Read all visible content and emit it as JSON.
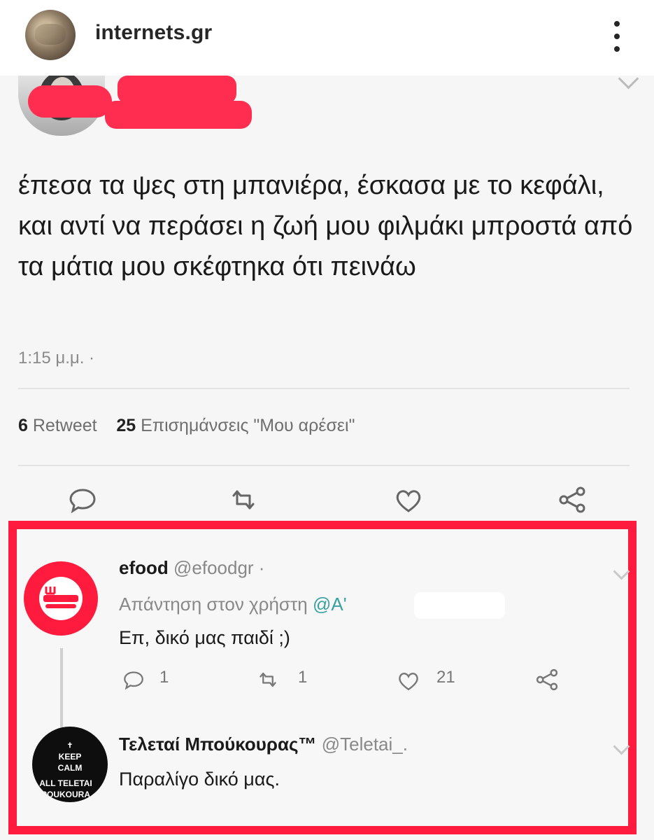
{
  "instagram": {
    "account_name": "internets.gr"
  },
  "tweet": {
    "text": "έπεσα τα ψες στη μπανιέρα, έσκασα με το κεφάλι, και αντί να περάσει η ζωή μου φιλμάκι μπροστά από τα μάτια μου σκέφτηκα ότι πεινάω",
    "time": "1:15 μ.μ. ·",
    "retweets_count": "6",
    "retweets_label": "Retweet",
    "likes_count": "25",
    "likes_label": "Επισημάνσεις \"Μου αρέσει\"",
    "actions": [
      "reply-icon",
      "retweet-icon",
      "like-icon",
      "share-icon"
    ]
  },
  "replies": [
    {
      "name": "efood",
      "handle": "@efoodgr ·",
      "replying_label": "Απάντηση στον χρήστη",
      "replying_mention": "@Α'",
      "text": "Επ, δικό μας παιδί ;)",
      "reply_count": "1",
      "retweet_count": "1",
      "like_count": "21"
    },
    {
      "name": "Τελεταί Μπούκουρας™",
      "handle": "@Teletai_.",
      "text": "Παραλίγο δικό μας.",
      "avatar_text": [
        "KEEP",
        "CALM",
        "ALL TELETAI",
        "POUKOURA"
      ]
    }
  ],
  "colors": {
    "highlight_red": "#ff1b3d",
    "redaction_red": "#ff2d4f",
    "mention_teal": "#3aa1a1"
  }
}
